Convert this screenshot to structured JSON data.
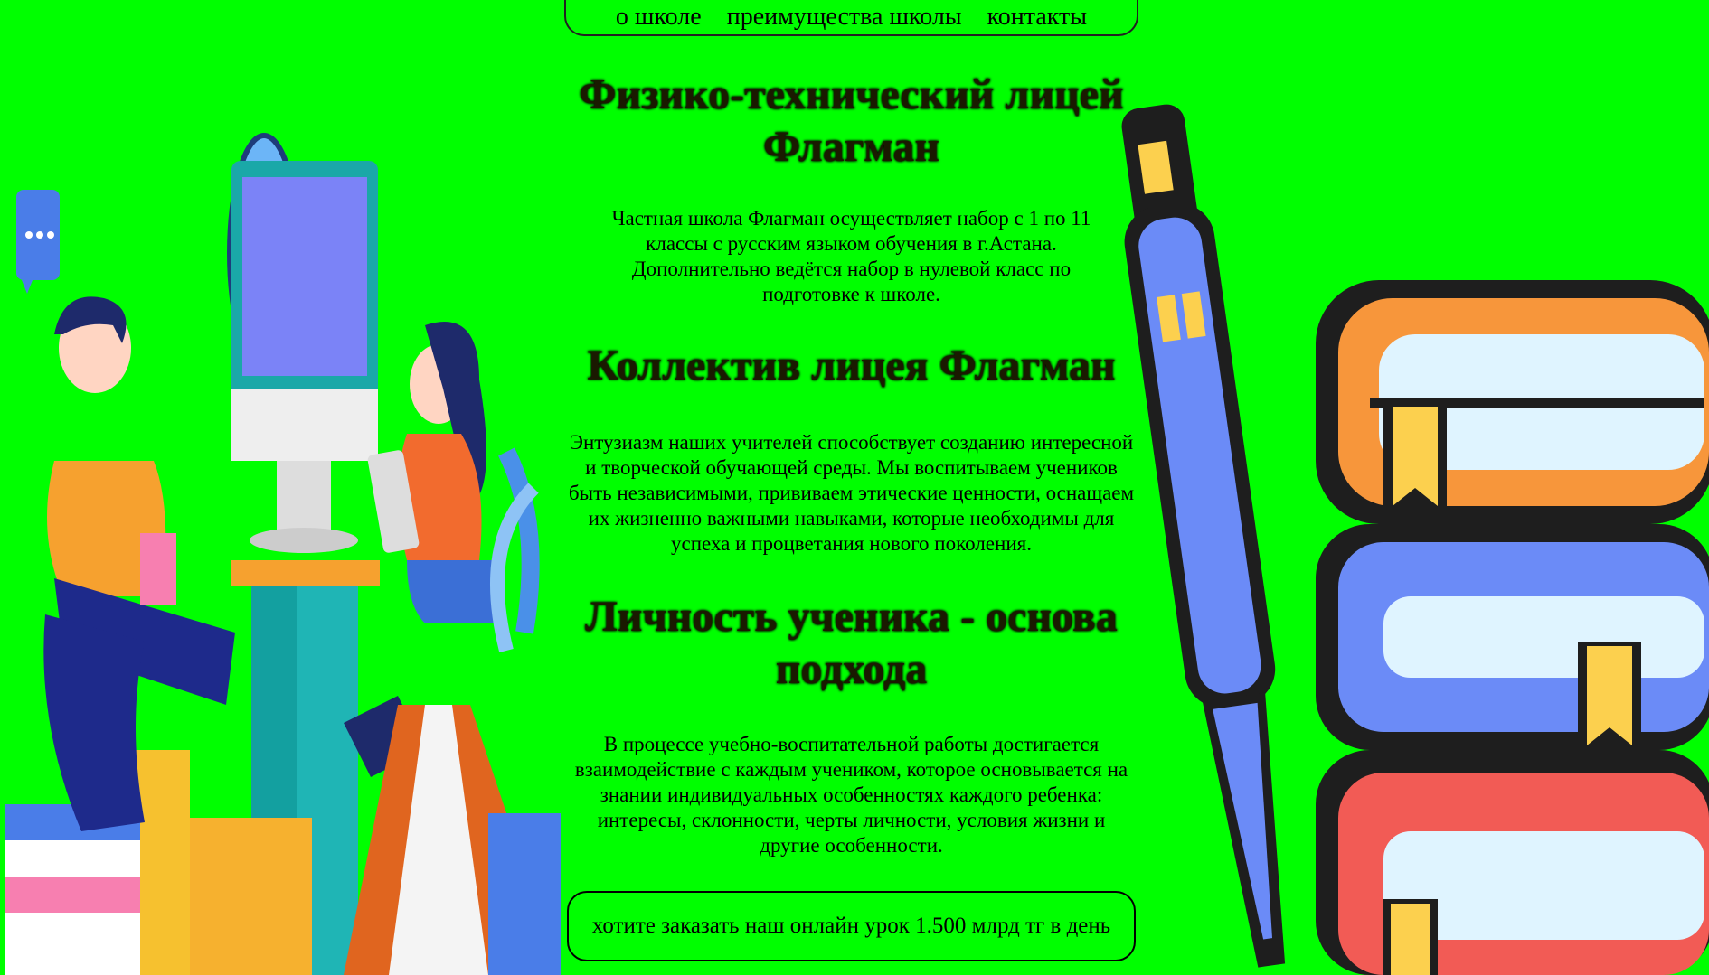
{
  "nav": {
    "items": [
      "о школе",
      "преимущества школы",
      "контакты"
    ]
  },
  "sections": [
    {
      "heading": "Физико-технический лицей Флагман",
      "text": "Частная школа Флагман осуществляет набор с 1 по 11 классы с русским языком обучения в г.Астана. Дополнительно ведётся набор в нулевой класс по подготовке к школе."
    },
    {
      "heading": "Коллектив лицея Флагман",
      "text": "Энтузиазм наших учителей способствует созданию интересной и творческой обучающей среды. Мы воспитываем учеников быть независимыми, прививаем этические ценности, оснащаем их жизненно важными навыками, которые необходимы для успеха и процветания нового поколения."
    },
    {
      "heading": "Личность ученика - основа подхода",
      "text": "В процессе учебно-воспитательной работы достигается взаимодействие с каждым учеником, которое основывается на знании индивидуальных особенностях каждого ребенка: интересы, склонности, черты личности, условия жизни и другие особенности."
    }
  ],
  "cta": {
    "label": "хотите заказать наш онлайн урок 1.500 млрд тг в день"
  },
  "colors": {
    "background": "#00ff00"
  }
}
